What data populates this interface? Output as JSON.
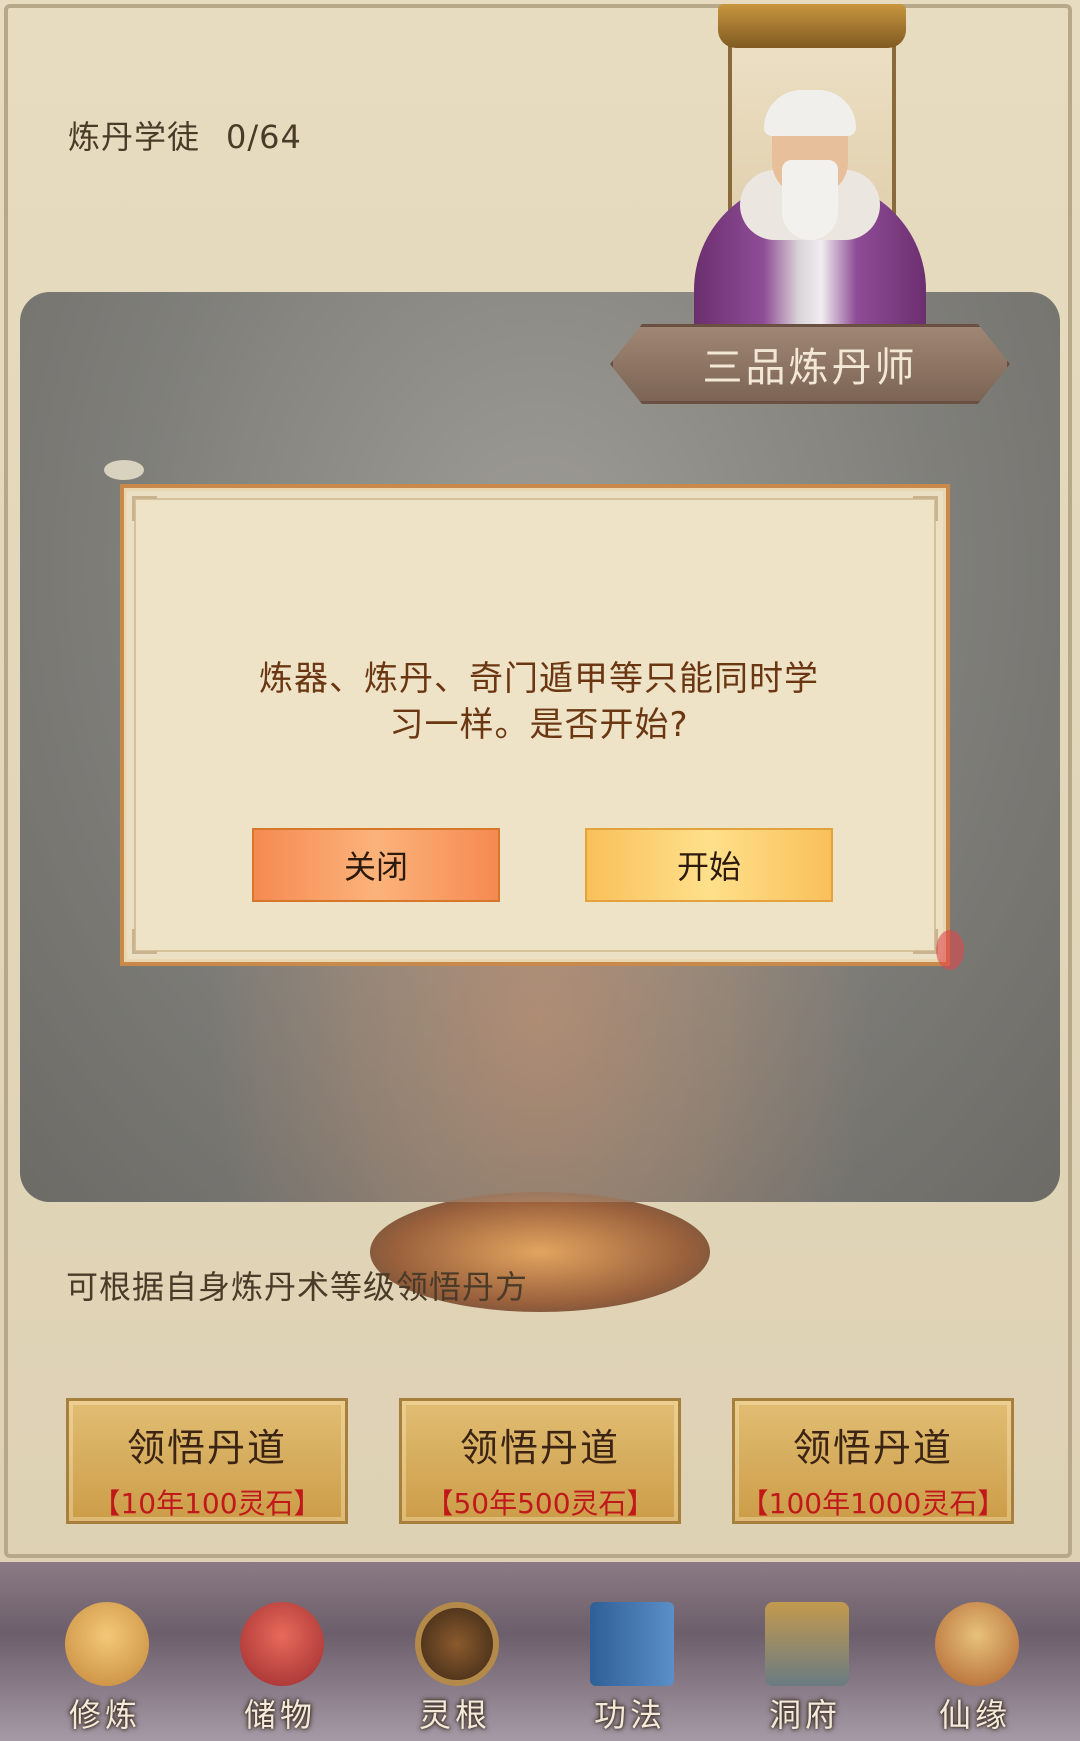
{
  "header": {
    "apprentice_label": "炼丹学徒",
    "apprentice_progress": "0/64"
  },
  "master": {
    "rank_title": "三品炼丹师"
  },
  "dialog": {
    "message_line1": "炼器、炼丹、奇门遁甲等只能同时学",
    "message_line2": "习一样。是否开始?",
    "close_label": "关闭",
    "start_label": "开始"
  },
  "hint": "可根据自身炼丹术等级领悟丹方",
  "learn_buttons": [
    {
      "title": "领悟丹道",
      "cost": "【10年100灵石】"
    },
    {
      "title": "领悟丹道",
      "cost": "【50年500灵石】"
    },
    {
      "title": "领悟丹道",
      "cost": "【100年1000灵石】"
    }
  ],
  "nav": [
    {
      "label": "修炼",
      "icon": "cultivation-icon"
    },
    {
      "label": "储物",
      "icon": "storage-bag-icon"
    },
    {
      "label": "灵根",
      "icon": "spirit-root-icon"
    },
    {
      "label": "功法",
      "icon": "scripture-book-icon"
    },
    {
      "label": "洞府",
      "icon": "cave-dwelling-icon"
    },
    {
      "label": "仙缘",
      "icon": "gourd-icon"
    }
  ],
  "colors": {
    "dialog_bg": "#eee3c6",
    "dialog_text": "#6b3712",
    "cost_red": "#c0181b",
    "close_button": "#f58a52",
    "start_button": "#f9c05a"
  }
}
